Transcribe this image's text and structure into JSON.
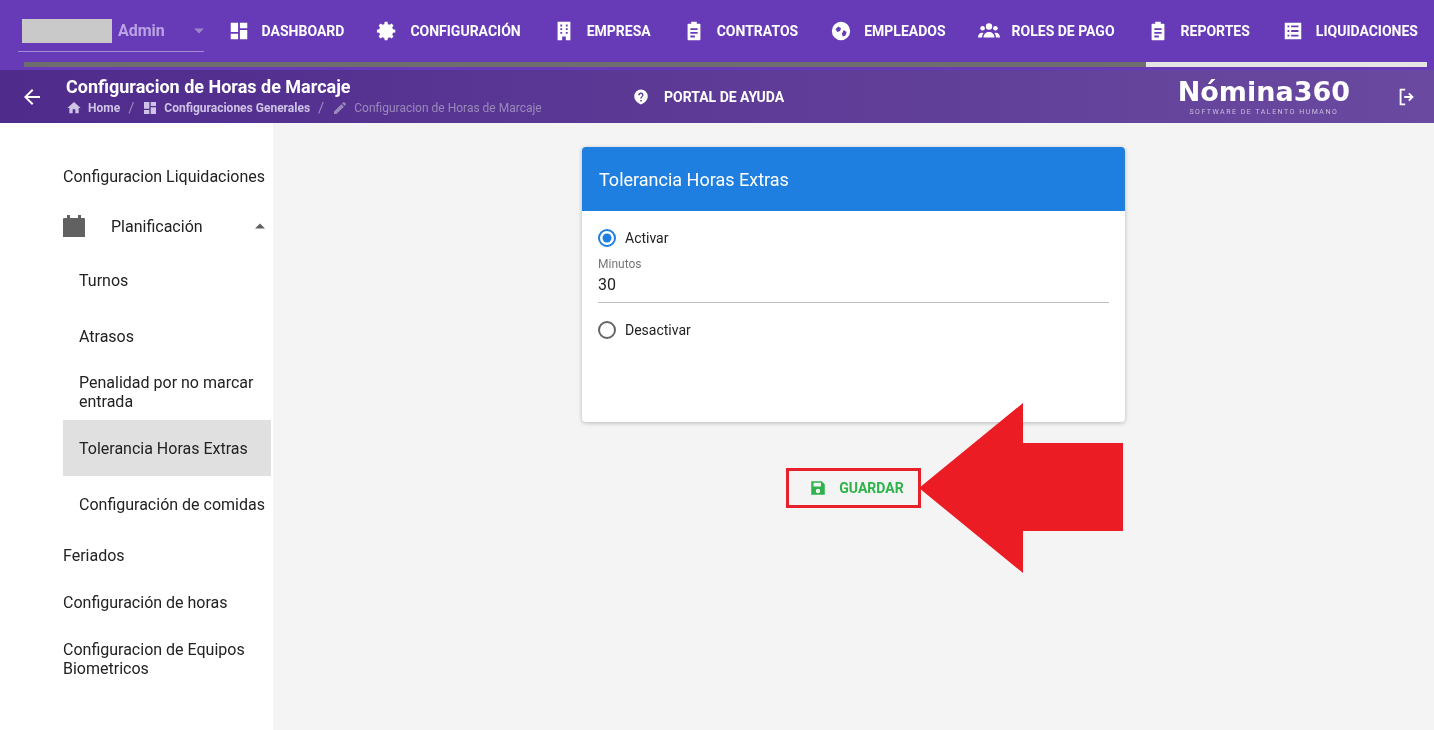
{
  "user_menu": {
    "name": "Admin"
  },
  "nav": [
    {
      "label": "DASHBOARD",
      "kind": "dashboard"
    },
    {
      "label": "CONFIGURACIÓN",
      "kind": "gear"
    },
    {
      "label": "EMPRESA",
      "kind": "building"
    },
    {
      "label": "CONTRATOS",
      "kind": "clipboard"
    },
    {
      "label": "EMPLEADOS",
      "kind": "globe"
    },
    {
      "label": "ROLES DE PAGO",
      "kind": "people"
    },
    {
      "label": "REPORTES",
      "kind": "clipboard"
    },
    {
      "label": "LIQUIDACIONES",
      "kind": "list"
    }
  ],
  "loading_bar": {
    "level": 0.8
  },
  "header": {
    "title": "Configuracion de Horas de Marcaje",
    "breadcrumbs": [
      {
        "label": "Home",
        "kind": "home"
      },
      {
        "separator": "/",
        "label": "Configuraciones Generales",
        "kind": "dashboard"
      },
      {
        "separator": "/",
        "label": "Configuracion de Horas de Marcaje",
        "kind": "pencil"
      }
    ],
    "help": "PORTAL DE AYUDA",
    "logo": "Nómina360",
    "logo_tagline": "SOFTWARE DE TALENTO HUMANO"
  },
  "sidebar": {
    "items": [
      {
        "label": "Configuracion Liquidaciones",
        "kind": "item",
        "selected": false
      },
      {
        "label": "Planificación",
        "kind": "group",
        "expanded": true,
        "children": [
          {
            "label": "Turnos",
            "selected": false
          },
          {
            "label": "Atrasos",
            "selected": false
          },
          {
            "label": "Penalidad por no marcar entrada",
            "selected": false
          },
          {
            "label": "Tolerancia Horas Extras",
            "selected": true
          },
          {
            "label": "Configuración de comidas",
            "selected": false
          }
        ]
      },
      {
        "label": "Feriados",
        "kind": "item",
        "selected": false
      },
      {
        "label": "Configuración de horas",
        "kind": "item",
        "selected": false
      },
      {
        "label": "Configuracion de Equipos Biometricos",
        "kind": "item",
        "selected": false
      }
    ]
  },
  "card": {
    "title": "Tolerancia Horas Extras",
    "options": [
      {
        "label": "Activar",
        "selected": true,
        "field": {
          "label": "Minutos",
          "value": "30"
        }
      },
      {
        "label": "Desactivar",
        "selected": false
      }
    ]
  },
  "save_button": {
    "label": "GUARDAR"
  }
}
